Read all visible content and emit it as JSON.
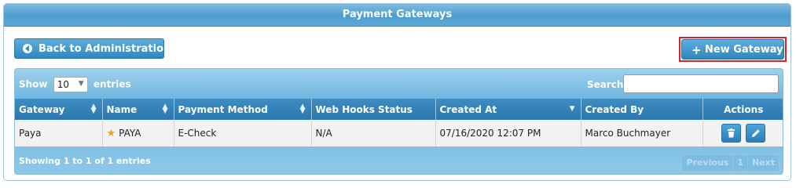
{
  "panel": {
    "title": "Payment Gateways"
  },
  "buttons": {
    "back_label": "Back to Administration",
    "new_label": "New Gateway"
  },
  "toolbar": {
    "show_label": "Show",
    "page_size": "10",
    "entries_label": "entries",
    "search_label": "Search:",
    "search_value": ""
  },
  "table": {
    "columns": [
      "Gateway",
      "Name",
      "Payment Method",
      "Web Hooks Status",
      "Created At",
      "Created By",
      "Actions"
    ],
    "rows": [
      {
        "gateway": "Paya",
        "name": "PAYA",
        "default": true,
        "payment_method": "E-Check",
        "webhooks_status": "N/A",
        "created_at": "07/16/2020 12:07 PM",
        "created_by": "Marco Buchmayer"
      }
    ]
  },
  "footer": {
    "info": "Showing 1 to 1 of 1 entries",
    "prev": "Previous",
    "page": "1",
    "next": "Next"
  },
  "icons": [
    "circle-left-icon",
    "plus-icon",
    "sort-icon",
    "sort-desc-icon",
    "star-icon",
    "trash-icon",
    "pencil-icon",
    "chevron-down-icon"
  ],
  "colors": {
    "header": "#4c9dd0",
    "button": "#2f86c0",
    "highlight_border": "#d2262c",
    "star": "#f0a020"
  }
}
